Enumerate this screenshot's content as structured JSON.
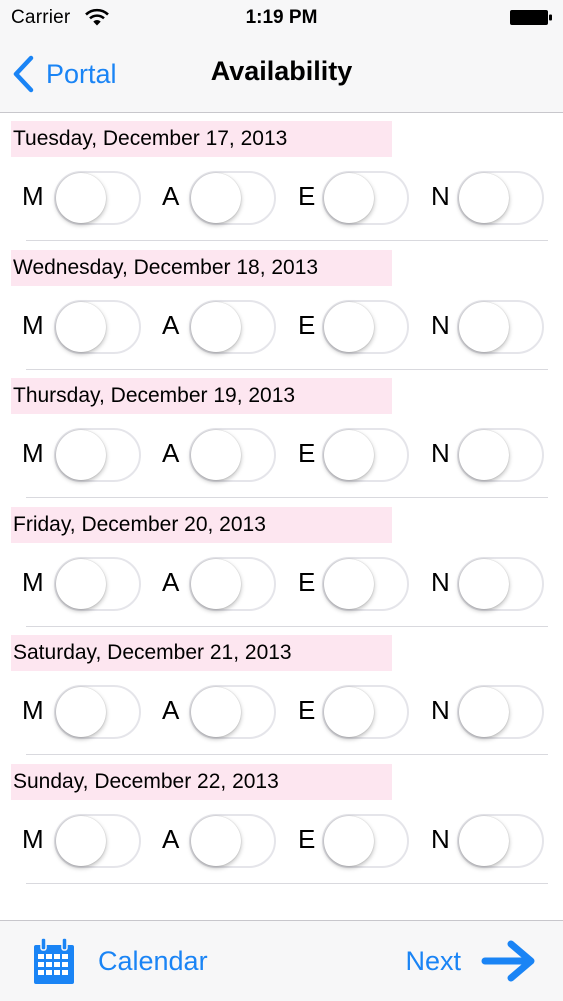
{
  "status_bar": {
    "carrier": "Carrier",
    "time": "1:19 PM"
  },
  "nav": {
    "back_label": "Portal",
    "title": "Availability"
  },
  "shift_labels": [
    "M",
    "A",
    "E",
    "N"
  ],
  "days": [
    {
      "date": "Tuesday, December 17, 2013",
      "shifts": [
        false,
        false,
        false,
        false
      ]
    },
    {
      "date": "Wednesday, December 18, 2013",
      "shifts": [
        false,
        false,
        false,
        false
      ]
    },
    {
      "date": "Thursday, December 19, 2013",
      "shifts": [
        false,
        false,
        false,
        false
      ]
    },
    {
      "date": "Friday, December 20, 2013",
      "shifts": [
        false,
        false,
        false,
        false
      ]
    },
    {
      "date": "Saturday, December 21, 2013",
      "shifts": [
        false,
        false,
        false,
        false
      ]
    },
    {
      "date": "Sunday, December 22, 2013",
      "shifts": [
        false,
        false,
        false,
        false
      ]
    }
  ],
  "toolbar": {
    "calendar_label": "Calendar",
    "next_label": "Next"
  },
  "colors": {
    "accent": "#1a84f5",
    "date_highlight": "#fde6f0",
    "switch_off_border": "#e5e5ea"
  },
  "icons": {
    "wifi": "wifi-icon",
    "battery": "battery-icon",
    "back": "chevron-left-icon",
    "calendar": "calendar-icon",
    "next": "arrow-right-icon"
  }
}
